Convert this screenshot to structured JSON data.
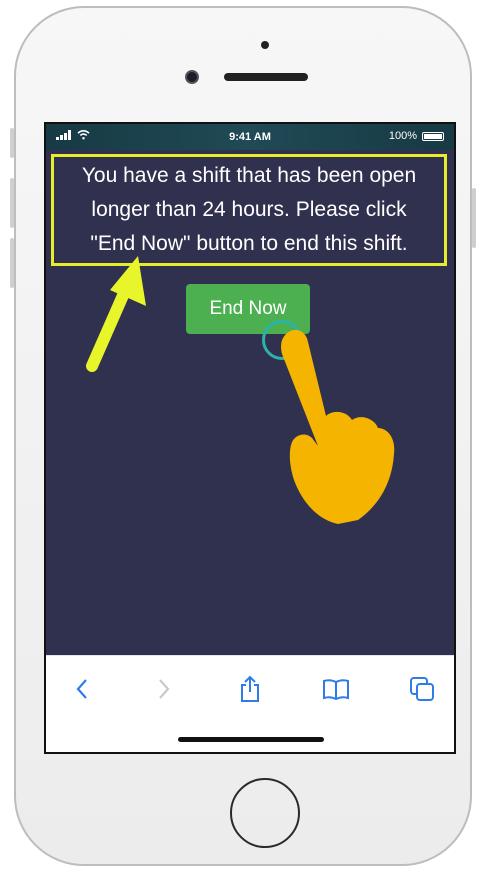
{
  "status_bar": {
    "time": "9:41 AM",
    "battery_text": "100%"
  },
  "message": {
    "line1": "You have a shift that has been open",
    "line2": "longer than 24 hours. Please click",
    "line3": "\"End Now\" button to end this shift."
  },
  "actions": {
    "end_now_label": "End Now"
  },
  "toolbar": {
    "items": [
      {
        "name": "back-icon",
        "enabled": true
      },
      {
        "name": "forward-icon",
        "enabled": false
      },
      {
        "name": "share-icon",
        "enabled": true
      },
      {
        "name": "bookmarks-icon",
        "enabled": true
      },
      {
        "name": "tabs-icon",
        "enabled": true
      }
    ]
  },
  "colors": {
    "screen_background": "#30304f",
    "highlight_border": "#e7ec2b",
    "button_green": "#4caf50",
    "toolbar_accent": "#2f7ce8",
    "hand_color": "#f4b400"
  }
}
